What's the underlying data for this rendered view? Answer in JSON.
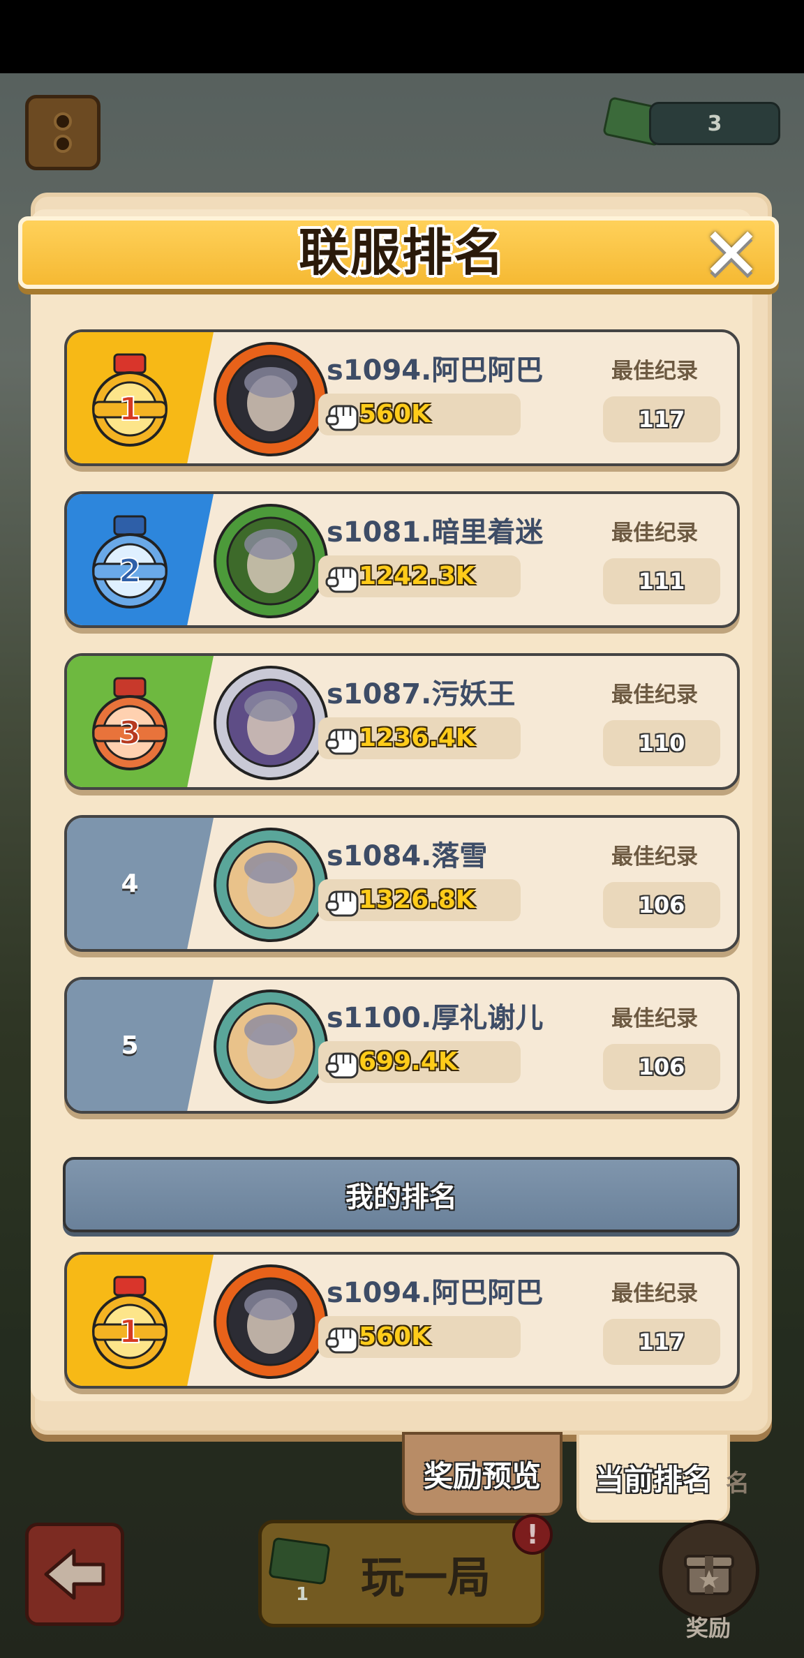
{
  "hud": {
    "ticket_count": "3"
  },
  "dialog": {
    "title": "联服排名",
    "close_symbol": "✕",
    "best_record_label": "最佳纪录",
    "my_rank_label": "我的排名"
  },
  "rankings": [
    {
      "rank": "1",
      "name": "s1094.阿巴阿巴",
      "power": "560K",
      "best": "117",
      "theme": "gold"
    },
    {
      "rank": "2",
      "name": "s1081.暗里着迷",
      "power": "1242.3K",
      "best": "111",
      "theme": "blue"
    },
    {
      "rank": "3",
      "name": "s1087.污妖王",
      "power": "1236.4K",
      "best": "110",
      "theme": "green"
    },
    {
      "rank": "4",
      "name": "s1084.落雪",
      "power": "1326.8K",
      "best": "106",
      "theme": "slate"
    },
    {
      "rank": "5",
      "name": "s1100.厚礼谢儿",
      "power": "699.4K",
      "best": "106",
      "theme": "slate"
    }
  ],
  "my_rank": {
    "rank": "1",
    "name": "s1094.阿巴阿巴",
    "power": "560K",
    "best": "117",
    "theme": "gold"
  },
  "tabs": {
    "reward_preview": "奖励预览",
    "current_rank": "当前排名"
  },
  "bottom": {
    "play_label": "玩一局",
    "play_ticket_count": "1",
    "alert_symbol": "!",
    "reward_label": "奖励",
    "background_tab_fragment": "名"
  },
  "colors": {
    "gold": "#f7b916",
    "blue": "#2d86dc",
    "green": "#6eb940",
    "slate": "#7d95ad",
    "power_text": "#ffcc1a"
  },
  "icons": {
    "rank_1": "gold-medal-icon",
    "rank_2": "silver-blue-medal-icon",
    "rank_3": "bronze-medal-icon",
    "power": "fist-icon",
    "back": "left-arrow-icon",
    "reward": "gift-box-icon"
  }
}
